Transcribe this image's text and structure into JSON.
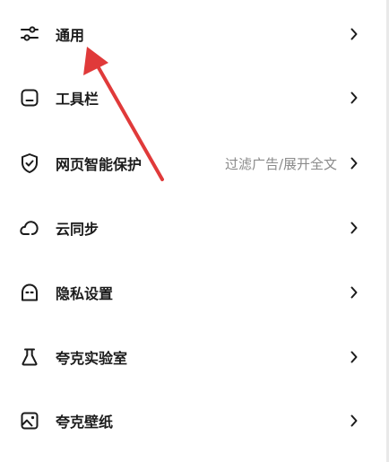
{
  "menu": {
    "items": [
      {
        "label": "通用",
        "icon": "sliders-icon",
        "desc": ""
      },
      {
        "label": "工具栏",
        "icon": "toolbar-icon",
        "desc": ""
      },
      {
        "label": "网页智能保护",
        "icon": "shield-check-icon",
        "desc": "过滤广告/展开全文"
      },
      {
        "label": "云同步",
        "icon": "cloud-icon",
        "desc": ""
      },
      {
        "label": "隐私设置",
        "icon": "privacy-mask-icon",
        "desc": ""
      },
      {
        "label": "夸克实验室",
        "icon": "flask-icon",
        "desc": ""
      },
      {
        "label": "夸克壁纸",
        "icon": "image-icon",
        "desc": ""
      }
    ]
  },
  "annotation": {
    "arrow_color": "#e03a3a"
  }
}
